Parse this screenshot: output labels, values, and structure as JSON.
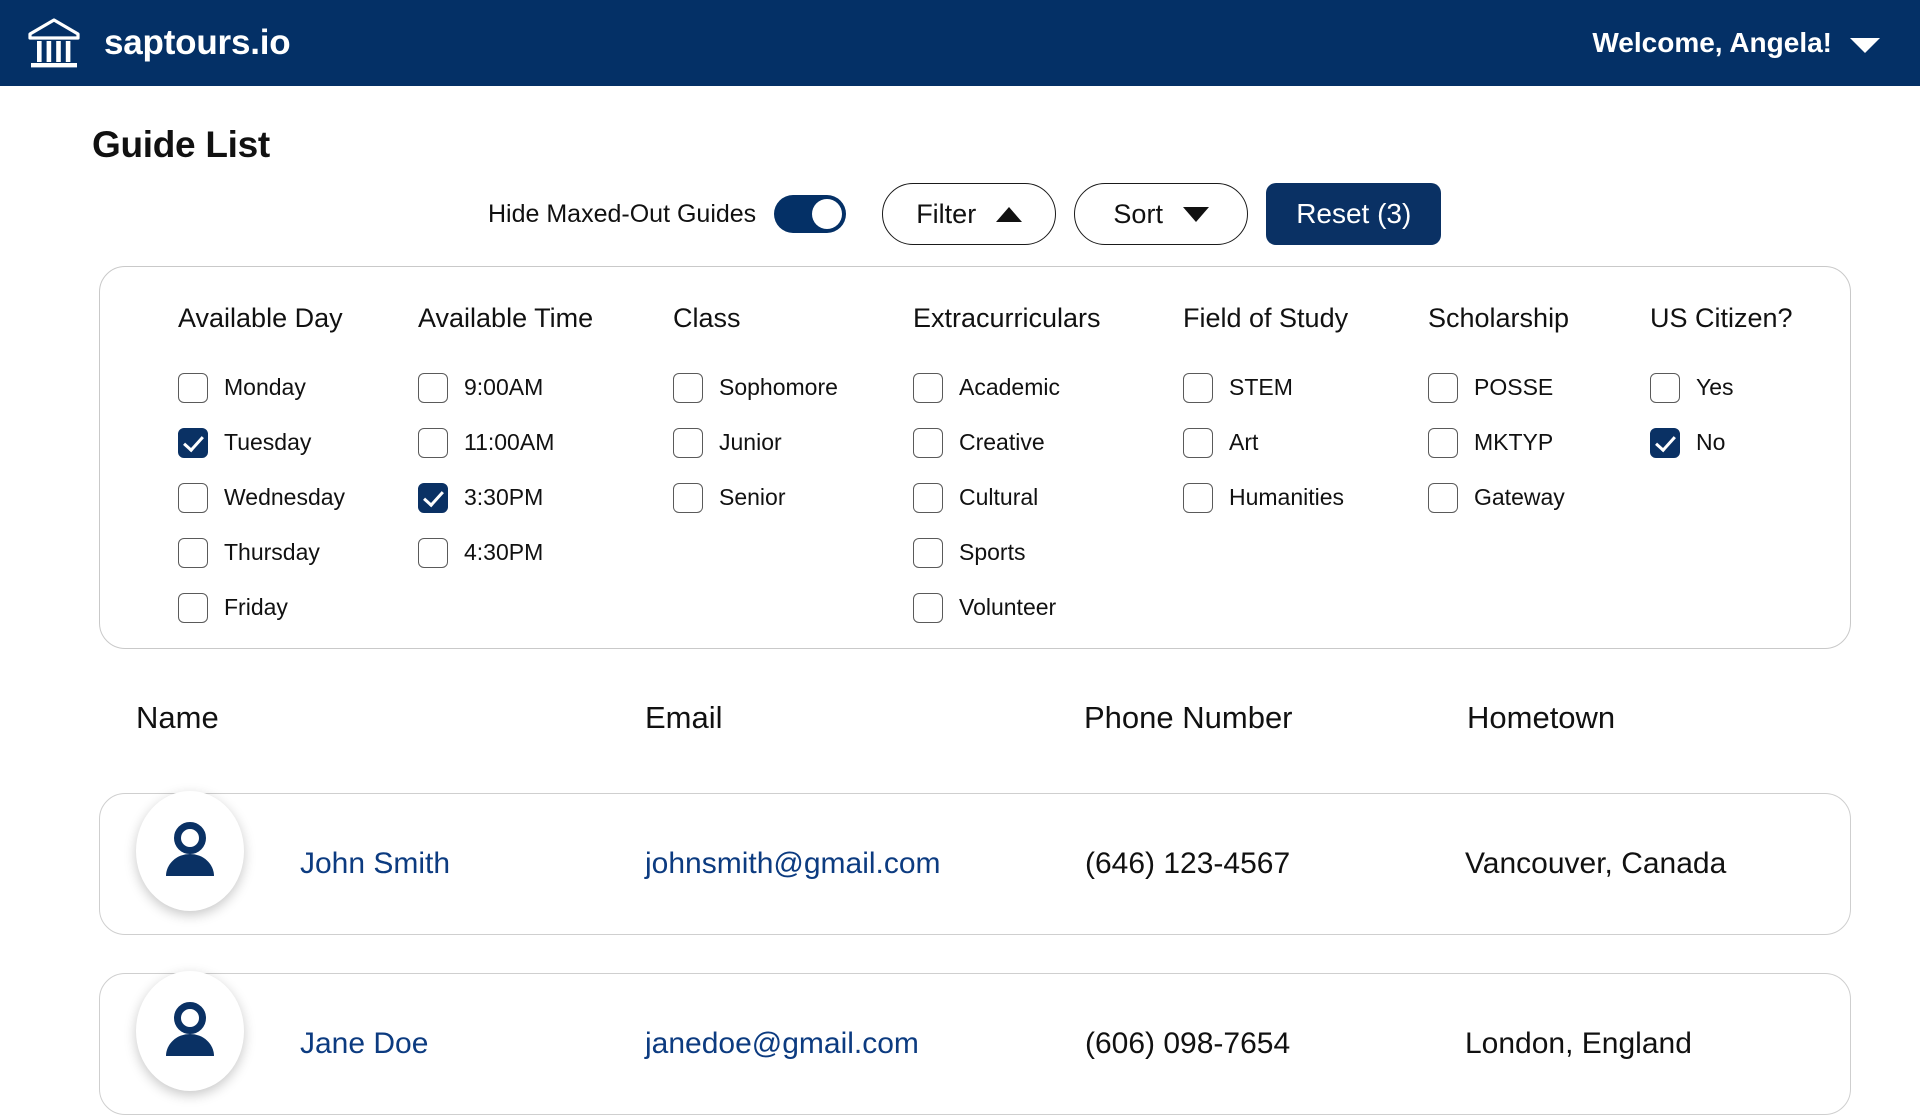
{
  "header": {
    "logo_icon": "bank-building-icon",
    "brand": "saptours.io",
    "welcome": "Welcome, Angela!",
    "caret_icon": "chevron-down-icon",
    "background_color": "#043066"
  },
  "page": {
    "title": "Guide List"
  },
  "toolbar": {
    "toggle_label": "Hide Maxed-Out Guides",
    "toggle_state": "on",
    "filter_label": "Filter",
    "filter_caret_icon": "triangle-up-icon",
    "sort_label": "Sort",
    "sort_caret_icon": "triangle-down-icon",
    "reset_label": "Reset (3)",
    "accent_color": "#0a3164"
  },
  "filters": {
    "columns": [
      {
        "title": "Available Day",
        "options": [
          {
            "label": "Monday",
            "checked": false
          },
          {
            "label": "Tuesday",
            "checked": true
          },
          {
            "label": "Wednesday",
            "checked": false
          },
          {
            "label": "Thursday",
            "checked": false
          },
          {
            "label": "Friday",
            "checked": false
          }
        ]
      },
      {
        "title": "Available Time",
        "options": [
          {
            "label": "9:00AM",
            "checked": false
          },
          {
            "label": "11:00AM",
            "checked": false
          },
          {
            "label": "3:30PM",
            "checked": true
          },
          {
            "label": "4:30PM",
            "checked": false
          }
        ]
      },
      {
        "title": "Class",
        "options": [
          {
            "label": "Sophomore",
            "checked": false
          },
          {
            "label": "Junior",
            "checked": false
          },
          {
            "label": "Senior",
            "checked": false
          }
        ]
      },
      {
        "title": "Extracurriculars",
        "options": [
          {
            "label": "Academic",
            "checked": false
          },
          {
            "label": "Creative",
            "checked": false
          },
          {
            "label": "Cultural",
            "checked": false
          },
          {
            "label": "Sports",
            "checked": false
          },
          {
            "label": "Volunteer",
            "checked": false
          }
        ]
      },
      {
        "title": "Field of Study",
        "options": [
          {
            "label": "STEM",
            "checked": false
          },
          {
            "label": "Art",
            "checked": false
          },
          {
            "label": "Humanities",
            "checked": false
          }
        ]
      },
      {
        "title": "Scholarship",
        "options": [
          {
            "label": "POSSE",
            "checked": false
          },
          {
            "label": "MKTYP",
            "checked": false
          },
          {
            "label": "Gateway",
            "checked": false
          }
        ]
      },
      {
        "title": "US Citizen?",
        "options": [
          {
            "label": "Yes",
            "checked": false
          },
          {
            "label": "No",
            "checked": true
          }
        ]
      }
    ]
  },
  "table": {
    "headers": {
      "name": "Name",
      "email": "Email",
      "phone": "Phone Number",
      "hometown": "Hometown"
    },
    "rows": [
      {
        "avatar_icon": "person-avatar-icon",
        "name": "John Smith",
        "email": "johnsmith@gmail.com",
        "phone": "(646) 123-4567",
        "hometown": "Vancouver, Canada"
      },
      {
        "avatar_icon": "person-avatar-icon",
        "name": "Jane Doe",
        "email": "janedoe@gmail.com",
        "phone": "(606) 098-7654",
        "hometown": "London, England"
      }
    ]
  }
}
